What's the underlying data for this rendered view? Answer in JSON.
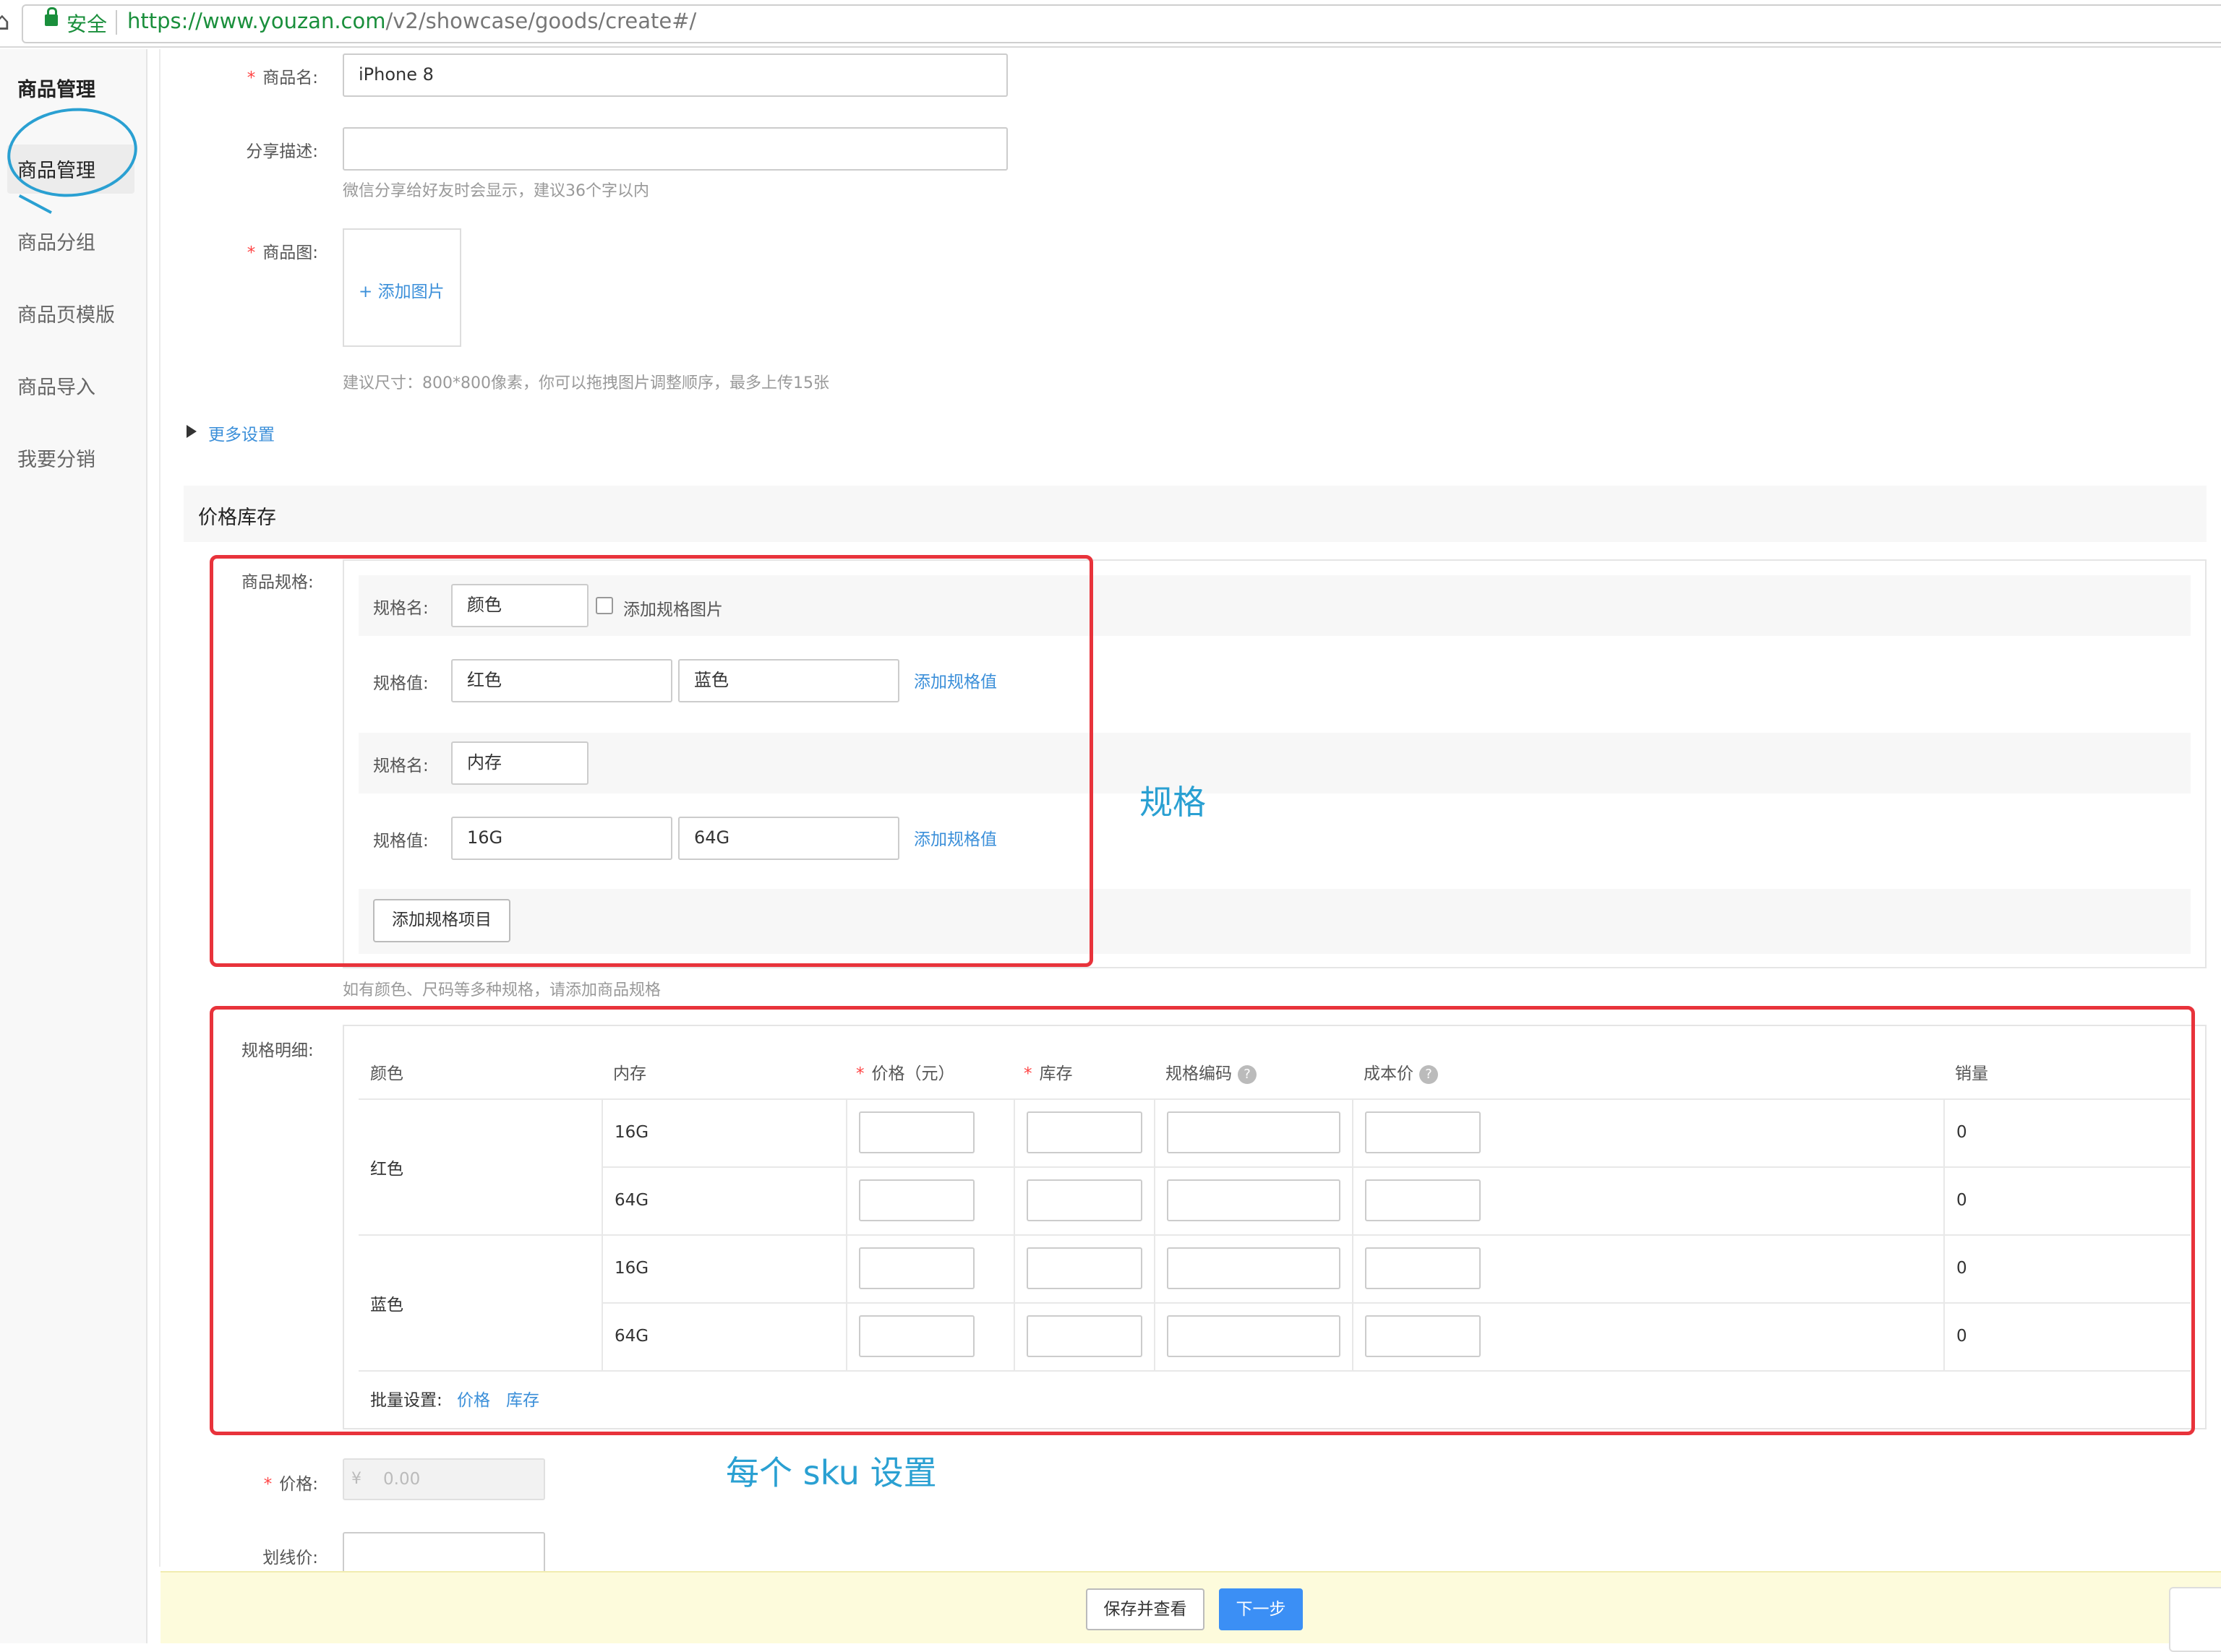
{
  "browser": {
    "secure_label": "安全",
    "url_host": "https://www.youzan.com",
    "url_path": "/v2/showcase/goods/create#/"
  },
  "sidebar": {
    "title": "商品管理",
    "items": [
      {
        "label": "商品管理"
      },
      {
        "label": "商品分组"
      },
      {
        "label": "商品页模版"
      },
      {
        "label": "商品导入"
      },
      {
        "label": "我要分销"
      }
    ]
  },
  "form": {
    "name_label": "商品名:",
    "name_value": "iPhone 8",
    "share_label": "分享描述:",
    "share_value": "",
    "share_hint": "微信分享给好友时会显示，建议36个字以内",
    "image_label": "商品图:",
    "add_image": "+ 添加图片",
    "image_hint": "建议尺寸：800*800像素，你可以拖拽图片调整顺序，最多上传15张",
    "more_settings": "更多设置",
    "price_section": "价格库存",
    "price_label": "价格:",
    "price_currency": "¥",
    "price_placeholder": "0.00",
    "strike_price_label": "划线价:"
  },
  "spec": {
    "label": "商品规格:",
    "name_label": "规格名:",
    "value_label": "规格值:",
    "add_spec_image": "添加规格图片",
    "add_value": "添加规格值",
    "add_item": "添加规格项目",
    "hint": "如有颜色、尺码等多种规格，请添加商品规格",
    "groups": [
      {
        "name": "颜色",
        "values": [
          "红色",
          "蓝色"
        ]
      },
      {
        "name": "内存",
        "values": [
          "16G",
          "64G"
        ]
      }
    ]
  },
  "sku": {
    "label": "规格明细:",
    "headers": {
      "color": "颜色",
      "memory": "内存",
      "price": "价格（元）",
      "stock": "库存",
      "code": "规格编码",
      "cost": "成本价",
      "sales": "销量"
    },
    "help": "?",
    "colors": [
      "红色",
      "蓝色"
    ],
    "rows": [
      {
        "memory": "16G",
        "sales": "0"
      },
      {
        "memory": "64G",
        "sales": "0"
      },
      {
        "memory": "16G",
        "sales": "0"
      },
      {
        "memory": "64G",
        "sales": "0"
      }
    ],
    "batch_label": "批量设置:",
    "batch_price": "价格",
    "batch_stock": "库存"
  },
  "annotations": {
    "spec": "规格",
    "sku": "每个 sku 设置",
    "color": "#2aa0d2",
    "box_color": "#e8333b"
  },
  "footer": {
    "save_preview": "保存并查看",
    "next": "下一步"
  }
}
